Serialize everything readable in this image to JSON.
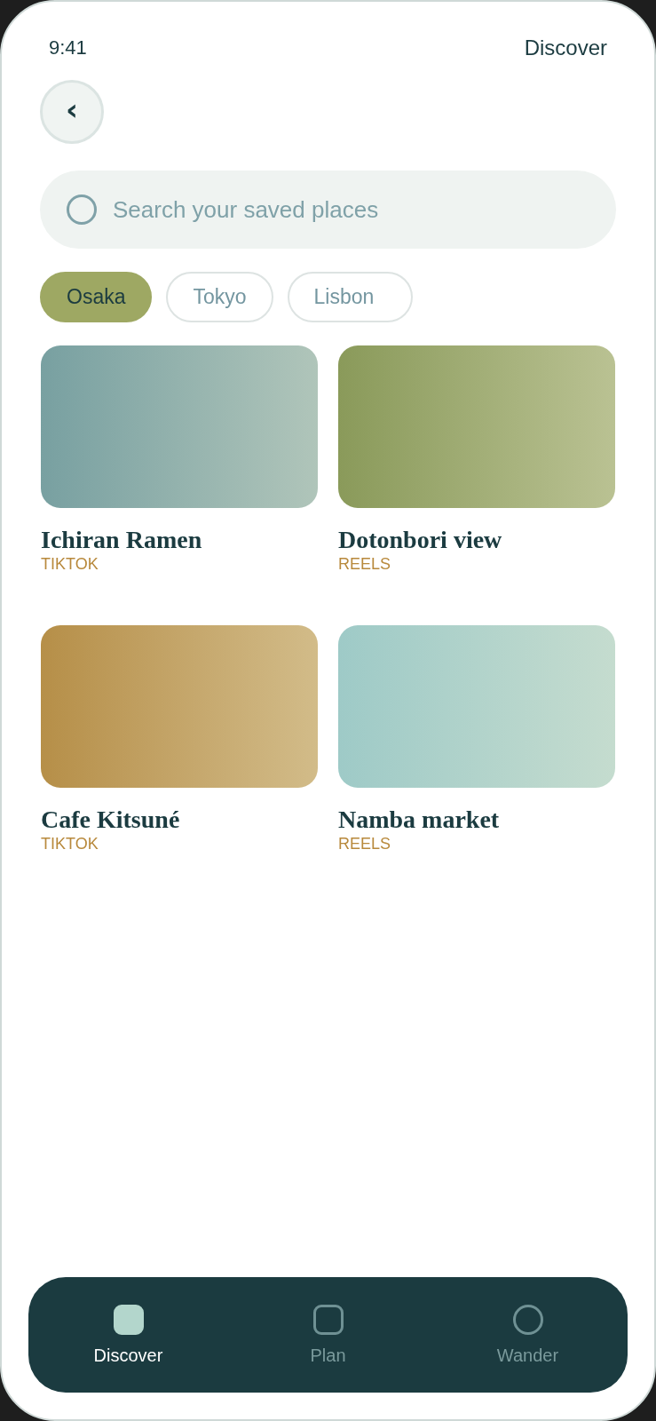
{
  "status_bar": {
    "time": "9:41",
    "title": "Discover"
  },
  "back_button": {
    "label": "‹"
  },
  "search": {
    "placeholder": "Search your saved places"
  },
  "filters": [
    {
      "label": "Osaka",
      "selected": true
    },
    {
      "label": "Tokyo",
      "selected": false
    },
    {
      "label": "Lisbon",
      "selected": false
    }
  ],
  "places": [
    {
      "title": "Ichiran Ramen",
      "source": "TIKTOK",
      "color": "#78a0a1"
    },
    {
      "title": "Dotonbori view",
      "source": "REELS",
      "color": "#8a9a5a"
    },
    {
      "title": "Cafe Kitsuné",
      "source": "TIKTOK",
      "color": "#b68f48"
    },
    {
      "title": "Namba market",
      "source": "REELS",
      "color": "#9ecac7"
    }
  ],
  "tab_bar": [
    {
      "label": "Discover",
      "kind": "square",
      "selected": true
    },
    {
      "label": "Plan",
      "kind": "square",
      "selected": false
    },
    {
      "label": "Wander",
      "kind": "circle",
      "selected": false
    }
  ]
}
